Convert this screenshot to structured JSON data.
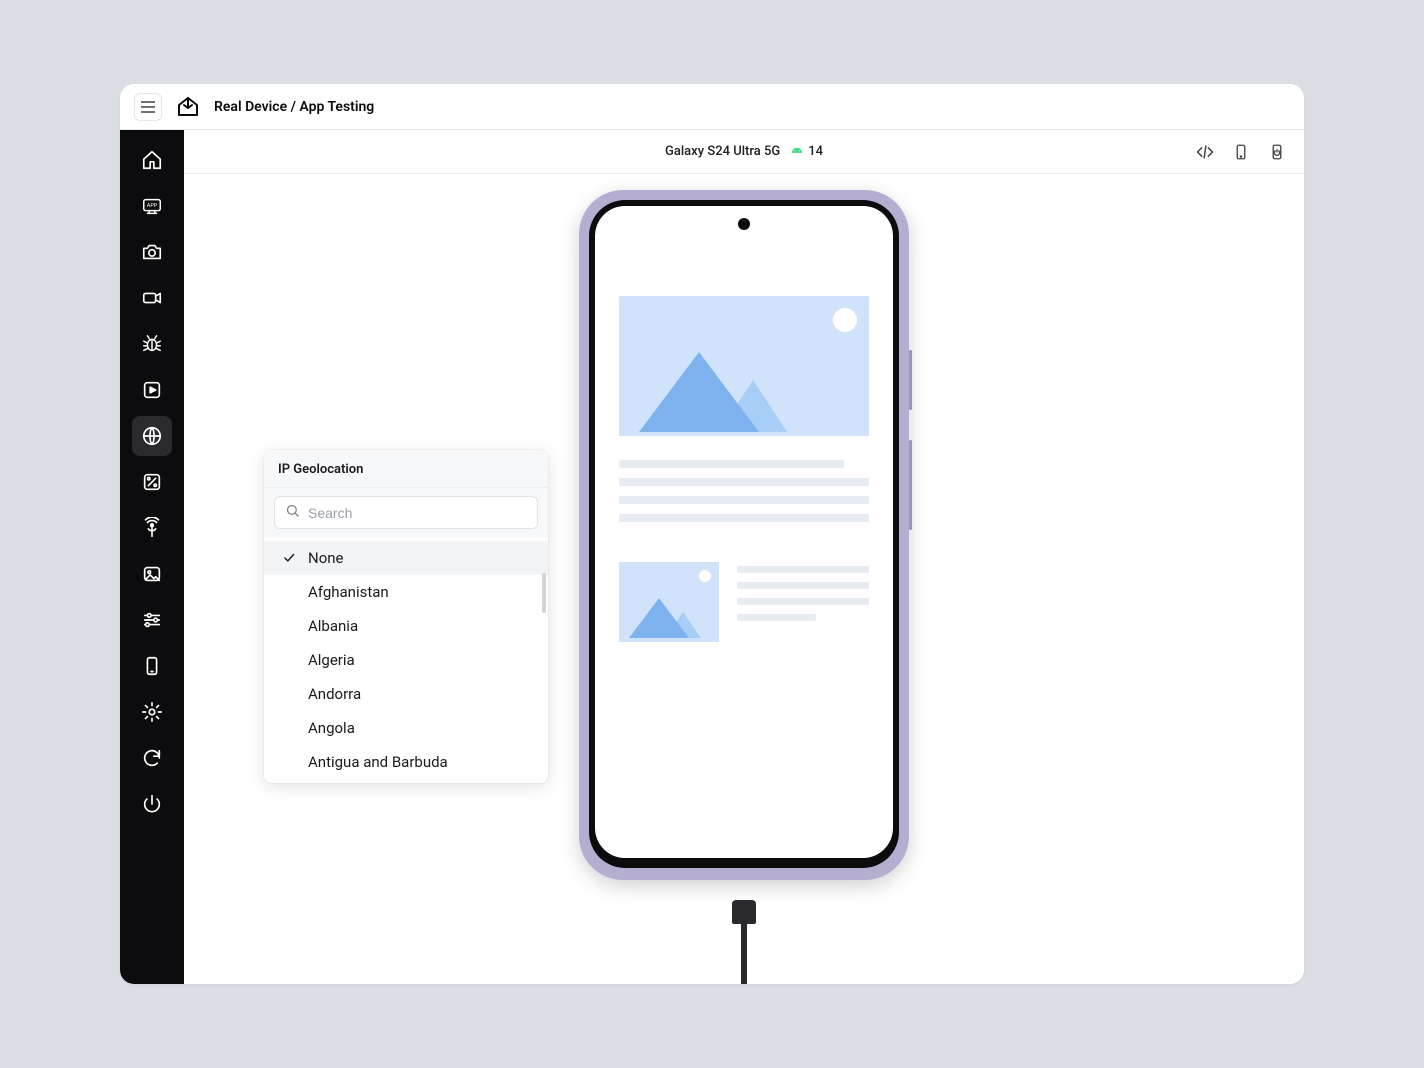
{
  "header": {
    "breadcrumb": "Real Device / App Testing"
  },
  "sub_header": {
    "device_name": "Galaxy S24 Ultra 5G",
    "os_version": "14"
  },
  "left_rail": {
    "items": [
      {
        "name": "home-icon"
      },
      {
        "name": "app-icon"
      },
      {
        "name": "camera-icon"
      },
      {
        "name": "video-icon"
      },
      {
        "name": "bug-icon"
      },
      {
        "name": "play-app-icon"
      },
      {
        "name": "globe-icon",
        "active": true
      },
      {
        "name": "map-percent-icon"
      },
      {
        "name": "network-signal-icon"
      },
      {
        "name": "image-icon"
      },
      {
        "name": "sliders-icon"
      },
      {
        "name": "phone-icon"
      },
      {
        "name": "gear-icon"
      },
      {
        "name": "refresh-icon"
      },
      {
        "name": "power-icon"
      }
    ]
  },
  "popup": {
    "title": "IP Geolocation",
    "search_placeholder": "Search",
    "items": [
      {
        "label": "None",
        "selected": true
      },
      {
        "label": "Afghanistan",
        "selected": false
      },
      {
        "label": "Albania",
        "selected": false
      },
      {
        "label": "Algeria",
        "selected": false
      },
      {
        "label": "Andorra",
        "selected": false
      },
      {
        "label": "Angola",
        "selected": false
      },
      {
        "label": "Antigua and Barbuda",
        "selected": false
      }
    ]
  }
}
